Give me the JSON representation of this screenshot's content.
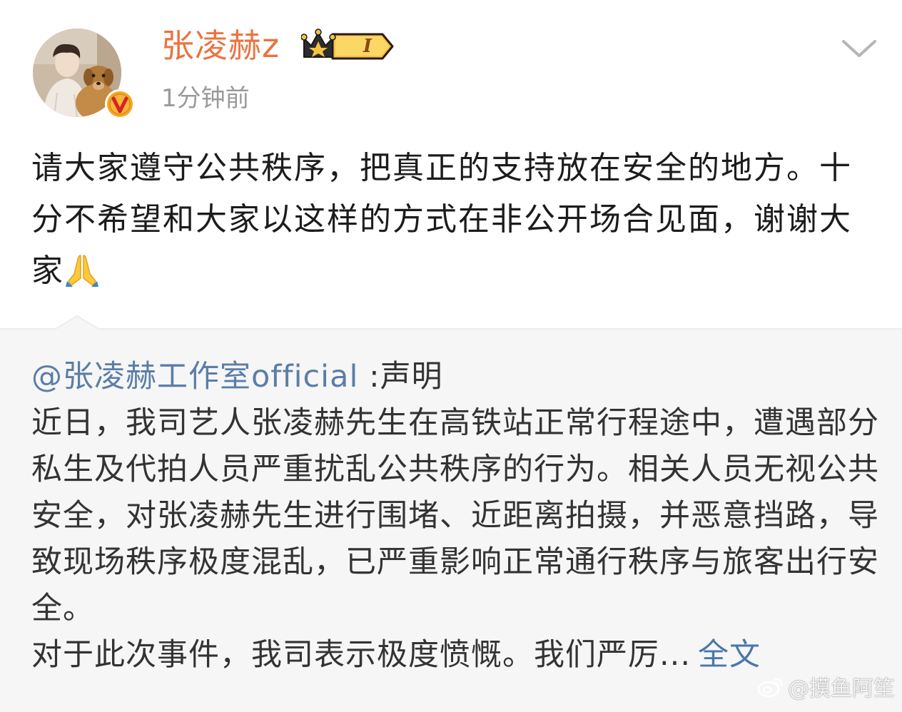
{
  "author": {
    "name": "张凌赫z",
    "vip_level": "I",
    "time": "1分钟前"
  },
  "post": {
    "text": "请大家遵守公共秩序，把真正的支持放在安全的地方。十分不希望和大家以这样的方式在非公开场合见面，谢谢大家",
    "emoji": "pray-emoji"
  },
  "repost": {
    "mention": "@张凌赫工作室official",
    "title": " :声明",
    "paragraph1": "近日，我司艺人张凌赫先生在高铁站正常行程途中，遭遇部分私生及代拍人员严重扰乱公共秩序的行为。相关人员无视公共安全，对张凌赫先生进行围堵、近距离拍摄，并恶意挡路，导致现场秩序极度混乱，已严重影响正常通行秩序与旅客出行安全。",
    "paragraph2": "对于此次事件，我司表示极度愤慨。我们严厉...",
    "full_text_label": "全文"
  },
  "watermark": {
    "text": "@摸鱼阿笙",
    "icon": "weibo-logo"
  },
  "colors": {
    "username": "#eb7340",
    "mention": "#5b7ea6",
    "link": "#4b78aa",
    "repost_bg": "#f6f6f6"
  }
}
